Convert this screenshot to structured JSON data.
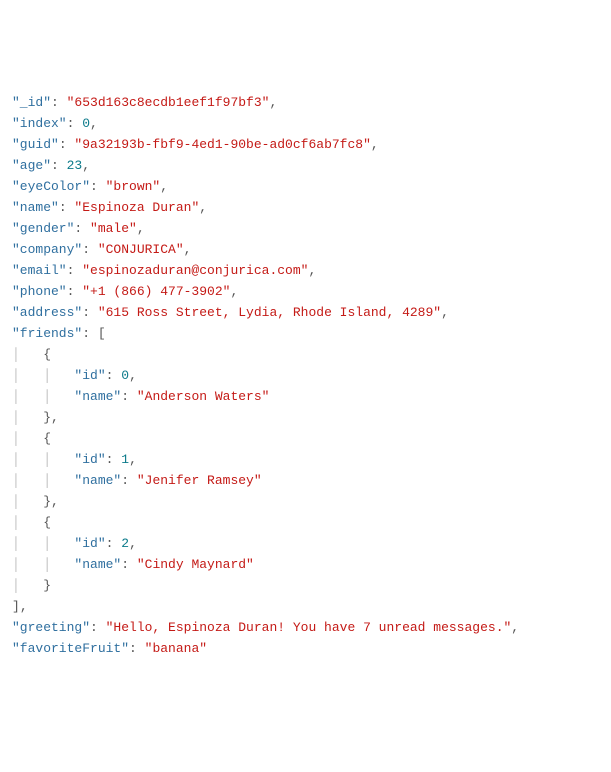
{
  "record": {
    "_id": "653d163c8ecdb1eef1f97bf3",
    "index": 0,
    "guid": "9a32193b-fbf9-4ed1-90be-ad0cf6ab7fc8",
    "age": 23,
    "eyeColor": "brown",
    "name": "Espinoza Duran",
    "gender": "male",
    "company": "CONJURICA",
    "email": "espinozaduran@conjurica.com",
    "phone": "+1 (866) 477-3902",
    "address": "615 Ross Street, Lydia, Rhode Island, 4289",
    "friends": [
      {
        "id": 0,
        "name": "Anderson Waters"
      },
      {
        "id": 1,
        "name": "Jenifer Ramsey"
      },
      {
        "id": 2,
        "name": "Cindy Maynard"
      }
    ],
    "greeting": "Hello, Espinoza Duran! You have 7 unread messages.",
    "favoriteFruit": "banana"
  },
  "keys": {
    "_id": "_id",
    "index": "index",
    "guid": "guid",
    "age": "age",
    "eyeColor": "eyeColor",
    "name": "name",
    "gender": "gender",
    "company": "company",
    "email": "email",
    "phone": "phone",
    "address": "address",
    "friends": "friends",
    "id": "id",
    "greeting": "greeting",
    "favoriteFruit": "favoriteFruit"
  }
}
